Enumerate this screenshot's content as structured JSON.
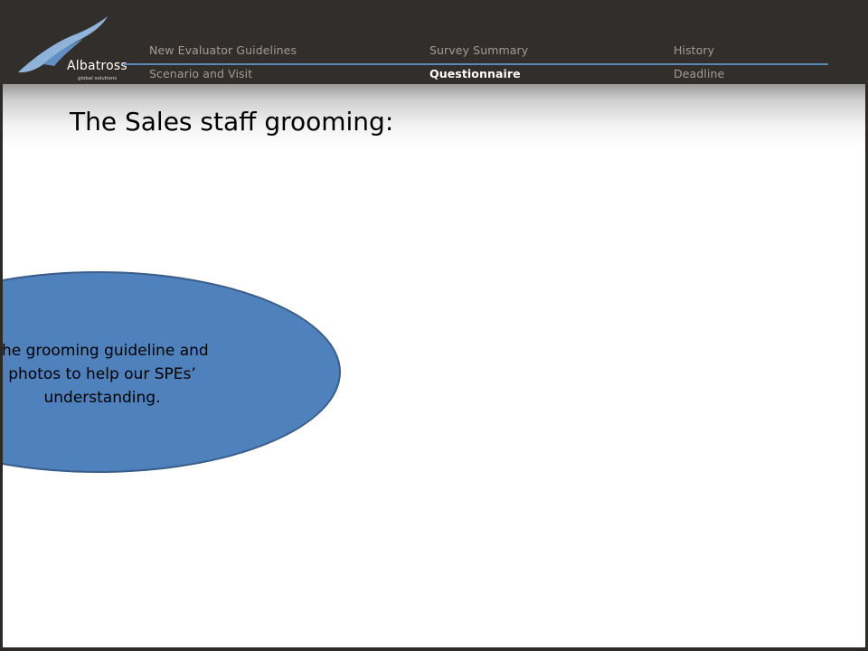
{
  "logo": {
    "name": "Albatross",
    "tagline": "global solutions"
  },
  "nav": {
    "row1": [
      "New Evaluator Guidelines",
      "Survey Summary",
      "History"
    ],
    "row2": [
      "Scenario and Visit",
      "Questionnaire",
      "Deadline"
    ],
    "active": "Questionnaire",
    "accent_color": "#5b86b5"
  },
  "slide": {
    "title": "The Sales staff grooming:",
    "callout": {
      "lines": [
        "the grooming guideline and",
        "photos to help our SPEs’",
        "understanding."
      ],
      "fill_color": "#4f81bd"
    }
  },
  "colors": {
    "header_bg": "#322e2b",
    "nav_text": "#a39c94",
    "nav_active_text": "#ffffff",
    "content_bg": "#ffffff"
  }
}
